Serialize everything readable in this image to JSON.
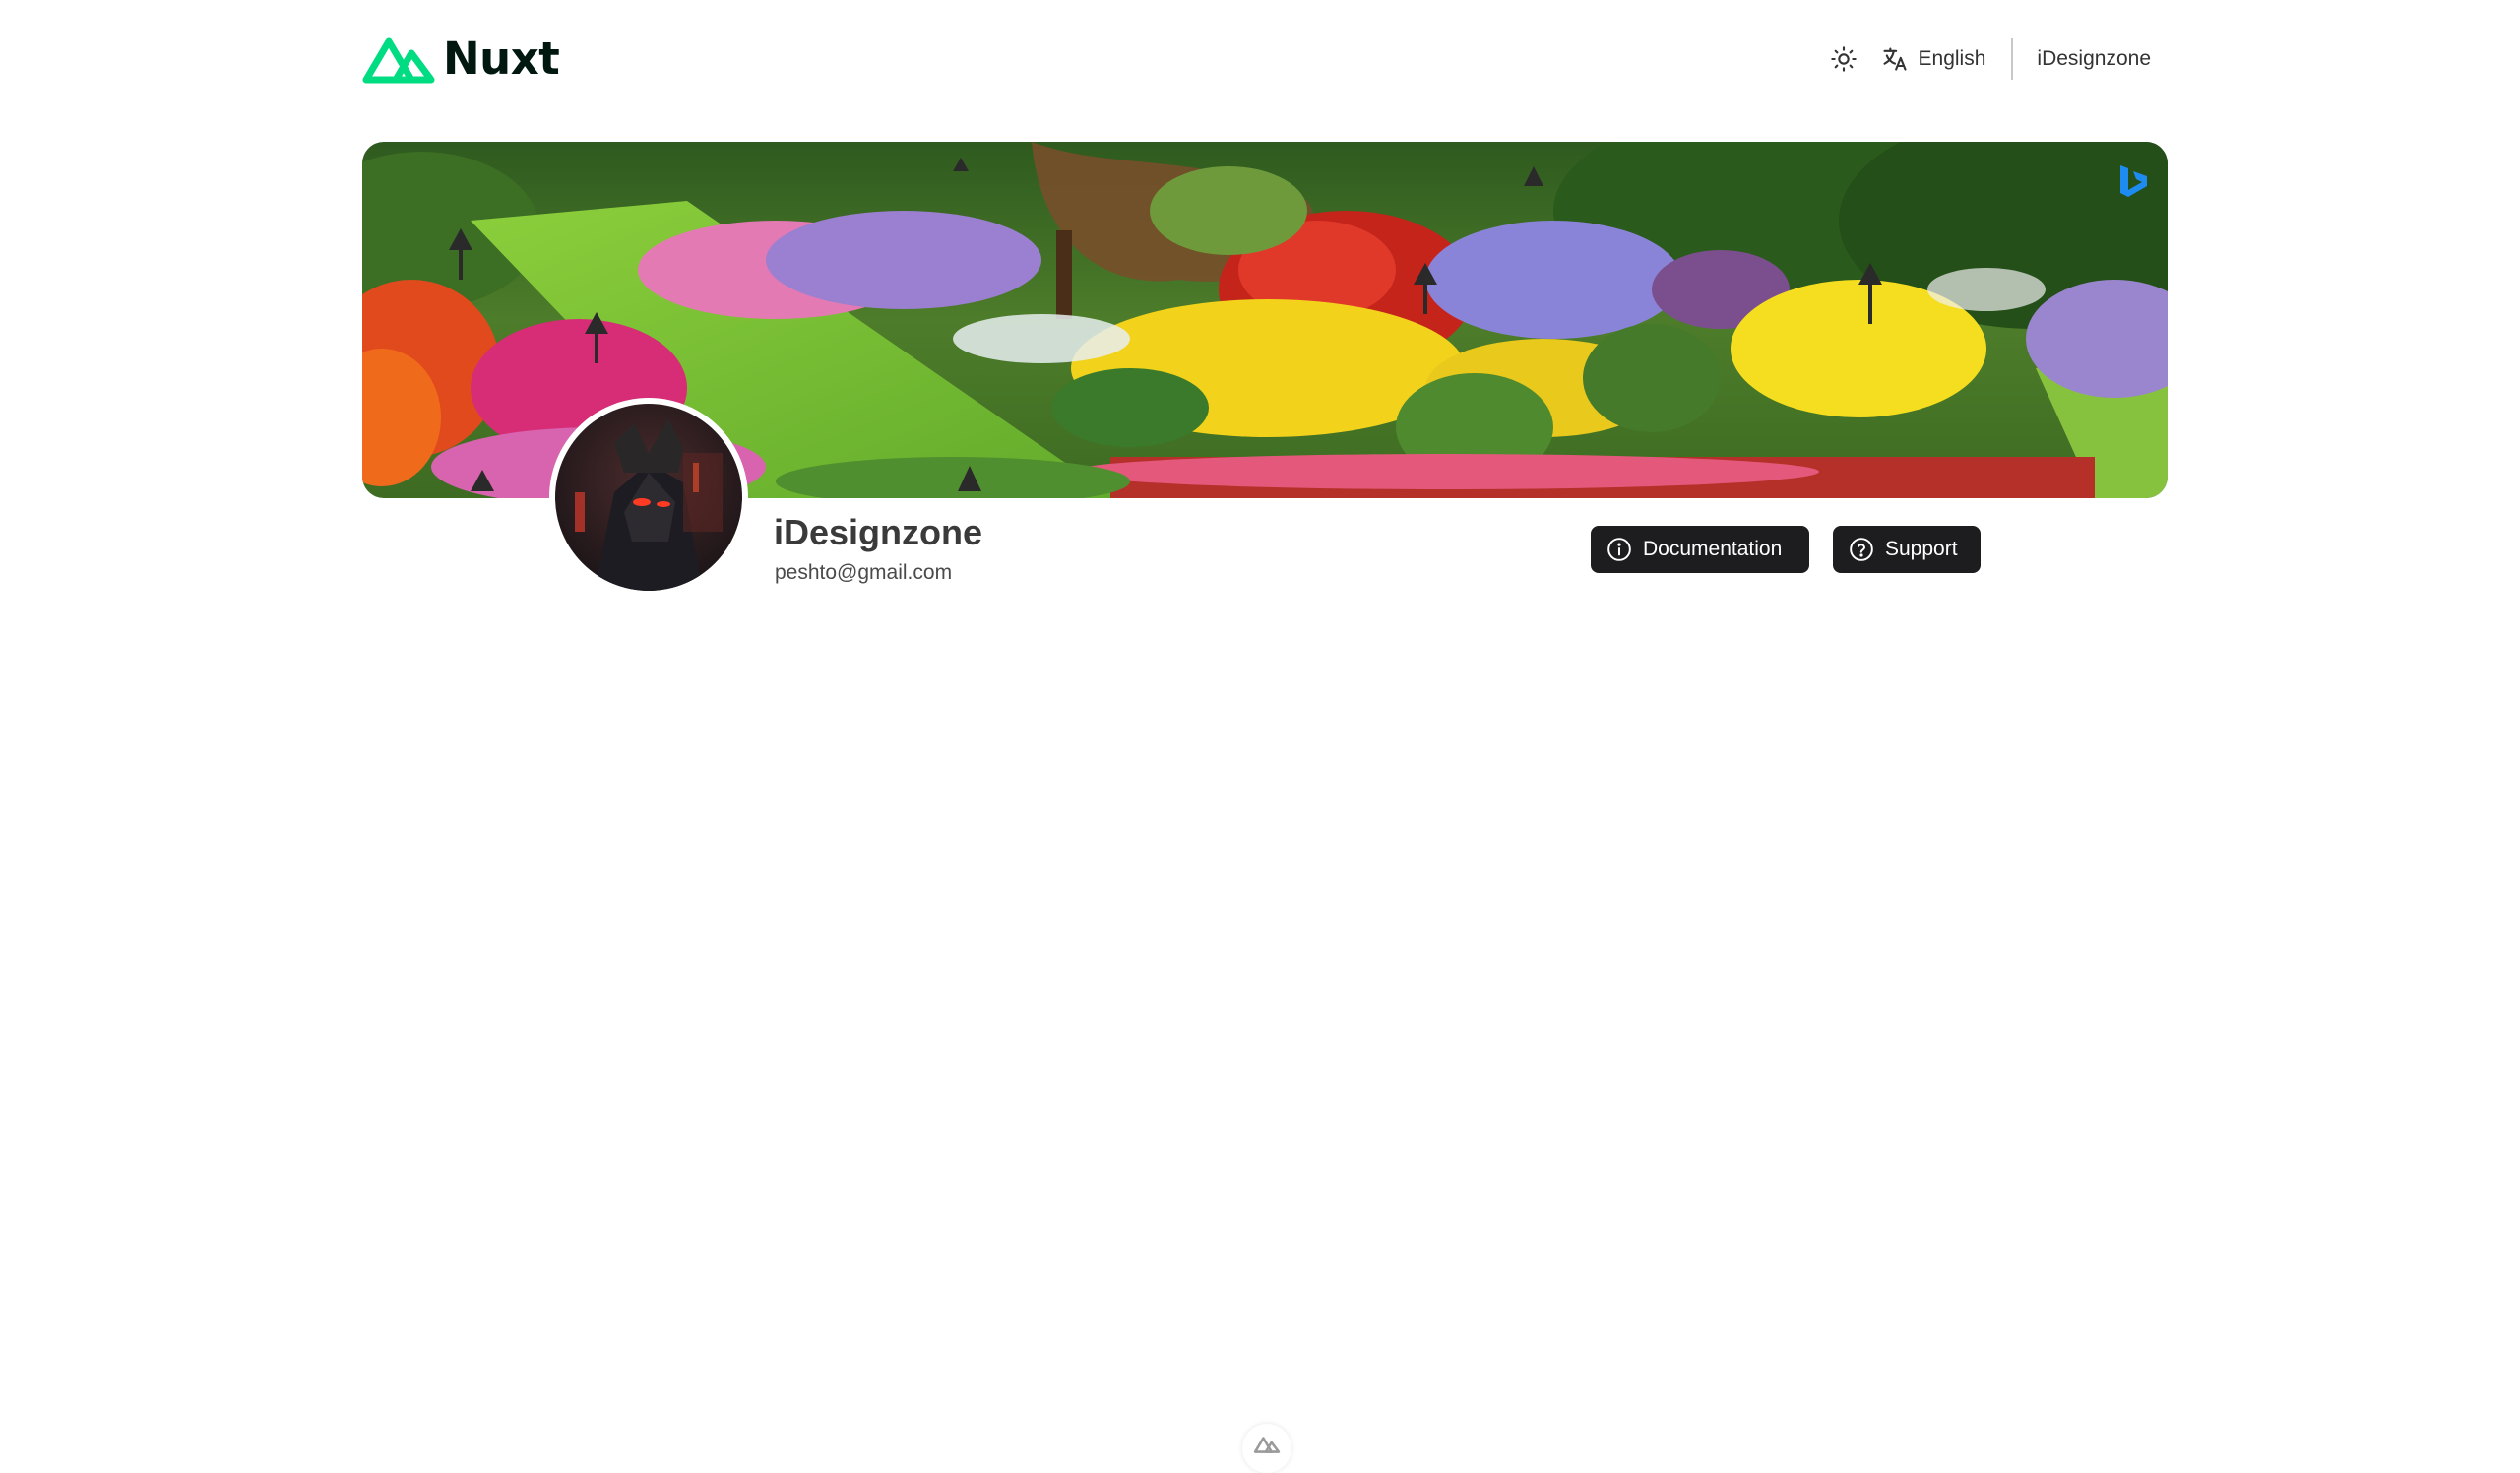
{
  "header": {
    "logo_text": "Nuxt",
    "theme_toggle_icon": "sun-icon",
    "language_label": "English",
    "language_icon": "translate-icon",
    "user_label": "iDesignzone"
  },
  "banner": {
    "image": "flower-garden-banner",
    "corner_icon": "bing-icon"
  },
  "profile": {
    "name": "iDesignzone",
    "email": "peshto@gmail.com",
    "avatar": "dark-armored-figure-avatar"
  },
  "actions": {
    "documentation_label": "Documentation",
    "documentation_icon": "info-circle-icon",
    "support_label": "Support",
    "support_icon": "question-circle-icon"
  },
  "devtools": {
    "icon": "nuxt-devtools-icon"
  },
  "colors": {
    "nuxt_green": "#00DC82",
    "logo_text": "#00180F",
    "button_bg": "#1D1D1F",
    "button_text": "#FFFFFF"
  }
}
